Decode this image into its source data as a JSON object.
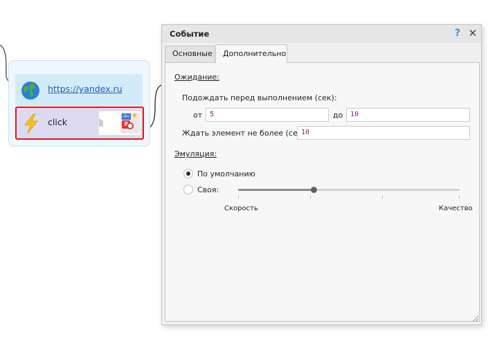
{
  "canvas": {
    "url_block": {
      "icon": "globe-icon",
      "label": "https://yandex.ru"
    },
    "click_block": {
      "icon": "lightning-icon",
      "label": "click",
      "thumb_badge": "div",
      "thumb_logo": "Я"
    }
  },
  "dialog": {
    "title": "Событие",
    "help_glyph": "?",
    "close_glyph": "✕",
    "tabs": [
      {
        "label": "Основные",
        "active": false
      },
      {
        "label": "Дополнительно",
        "active": true
      }
    ],
    "wait": {
      "section": "Ожидание:",
      "before_label": "Подождать перед выполнением (сек):",
      "from_label": "от",
      "from_value": "5",
      "to_label": "до",
      "to_value": "10",
      "element_label": "Ждать элемент не более (сек):",
      "element_value": "10"
    },
    "emulation": {
      "section": "Эмуляция:",
      "options": [
        {
          "label": "По умолчанию",
          "selected": true
        },
        {
          "label": "Своя:",
          "selected": false
        }
      ],
      "slider": {
        "value": 0.34,
        "min_label": "Скорость",
        "max_label": "Качество"
      }
    }
  },
  "colors": {
    "selection_border": "#e0161e",
    "link": "#1c5fa8",
    "help": "#3b8fd6",
    "field_text": "#7a1f6e"
  }
}
